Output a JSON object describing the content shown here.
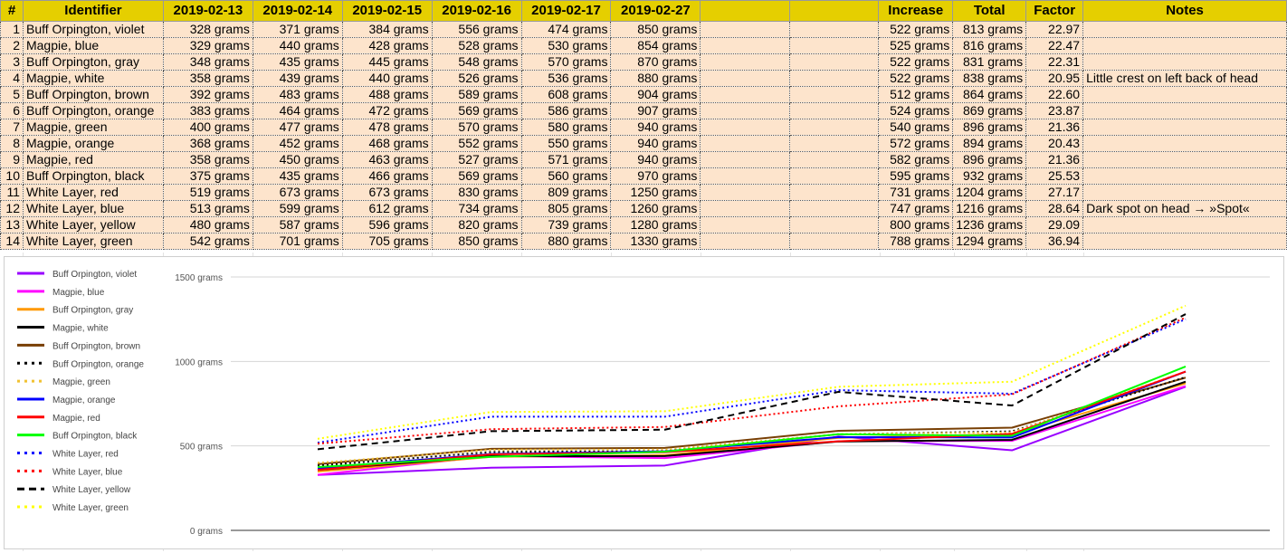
{
  "sheet": {
    "headers": [
      "#",
      "Identifier",
      "2019-02-13",
      "2019-02-14",
      "2019-02-15",
      "2019-02-16",
      "2019-02-17",
      "2019-02-27",
      "",
      "",
      "Increase",
      "Total",
      "Factor",
      "Notes"
    ],
    "rows": [
      [
        "1",
        "Buff Orpington, violet",
        "328 grams",
        "371 grams",
        "384 grams",
        "556 grams",
        "474 grams",
        "850 grams",
        "",
        "",
        "522 grams",
        "813 grams",
        "22.97",
        ""
      ],
      [
        "2",
        "Magpie, blue",
        "329 grams",
        "440 grams",
        "428 grams",
        "528 grams",
        "530 grams",
        "854 grams",
        "",
        "",
        "525 grams",
        "816 grams",
        "22.47",
        ""
      ],
      [
        "3",
        "Buff Orpington, gray",
        "348 grams",
        "435 grams",
        "445 grams",
        "548 grams",
        "570 grams",
        "870 grams",
        "",
        "",
        "522 grams",
        "831 grams",
        "22.31",
        ""
      ],
      [
        "4",
        "Magpie, white",
        "358 grams",
        "439 grams",
        "440 grams",
        "526 grams",
        "536 grams",
        "880 grams",
        "",
        "",
        "522 grams",
        "838 grams",
        "20.95",
        "Little crest on left back of head"
      ],
      [
        "5",
        "Buff Orpington, brown",
        "392 grams",
        "483 grams",
        "488 grams",
        "589 grams",
        "608 grams",
        "904 grams",
        "",
        "",
        "512 grams",
        "864 grams",
        "22.60",
        ""
      ],
      [
        "6",
        "Buff Orpington, orange",
        "383 grams",
        "464 grams",
        "472 grams",
        "569 grams",
        "586 grams",
        "907 grams",
        "",
        "",
        "524 grams",
        "869 grams",
        "23.87",
        ""
      ],
      [
        "7",
        "Magpie, green",
        "400 grams",
        "477 grams",
        "478 grams",
        "570 grams",
        "580 grams",
        "940 grams",
        "",
        "",
        "540 grams",
        "896 grams",
        "21.36",
        ""
      ],
      [
        "8",
        "Magpie, orange",
        "368 grams",
        "452 grams",
        "468 grams",
        "552 grams",
        "550 grams",
        "940 grams",
        "",
        "",
        "572 grams",
        "894 grams",
        "20.43",
        ""
      ],
      [
        "9",
        "Magpie, red",
        "358 grams",
        "450 grams",
        "463 grams",
        "527 grams",
        "571 grams",
        "940 grams",
        "",
        "",
        "582 grams",
        "896 grams",
        "21.36",
        ""
      ],
      [
        "10",
        "Buff Orpington, black",
        "375 grams",
        "435 grams",
        "466 grams",
        "569 grams",
        "560 grams",
        "970 grams",
        "",
        "",
        "595 grams",
        "932 grams",
        "25.53",
        ""
      ],
      [
        "11",
        "White Layer, red",
        "519 grams",
        "673 grams",
        "673 grams",
        "830 grams",
        "809 grams",
        "1250 grams",
        "",
        "",
        "731 grams",
        "1204 grams",
        "27.17",
        ""
      ],
      [
        "12",
        "White Layer, blue",
        "513 grams",
        "599 grams",
        "612 grams",
        "734 grams",
        "805 grams",
        "1260 grams",
        "",
        "",
        "747 grams",
        "1216 grams",
        "28.64",
        "Dark spot on head → »Spot«"
      ],
      [
        "13",
        "White Layer, yellow",
        "480 grams",
        "587 grams",
        "596 grams",
        "820 grams",
        "739 grams",
        "1280 grams",
        "",
        "",
        "800 grams",
        "1236 grams",
        "29.09",
        ""
      ],
      [
        "14",
        "White Layer, green",
        "542 grams",
        "701 grams",
        "705 grams",
        "850 grams",
        "880 grams",
        "1330 grams",
        "",
        "",
        "788 grams",
        "1294 grams",
        "36.94",
        ""
      ]
    ]
  },
  "chart_data": {
    "type": "line",
    "x": [
      "2019-02-13",
      "2019-02-14",
      "2019-02-15",
      "2019-02-16",
      "2019-02-17",
      "2019-02-27"
    ],
    "ylim": [
      0,
      1500
    ],
    "yticks": [
      {
        "value": 0,
        "label": "0 grams"
      },
      {
        "value": 500,
        "label": "500 grams"
      },
      {
        "value": 1000,
        "label": "1000 grams"
      },
      {
        "value": 1500,
        "label": "1500 grams"
      }
    ],
    "grid": true,
    "legend": "left",
    "series": [
      {
        "name": "Buff Orpington, violet",
        "color": "#9900ff",
        "dash": "solid",
        "values": [
          328,
          371,
          384,
          556,
          474,
          850
        ]
      },
      {
        "name": "Magpie, blue",
        "color": "#ff00ff",
        "dash": "solid",
        "values": [
          329,
          440,
          428,
          528,
          530,
          854
        ]
      },
      {
        "name": "Buff Orpington, gray",
        "color": "#ff9900",
        "dash": "solid",
        "values": [
          348,
          435,
          445,
          548,
          570,
          870
        ]
      },
      {
        "name": "Magpie, white",
        "color": "#000000",
        "dash": "solid",
        "values": [
          358,
          439,
          440,
          526,
          536,
          880
        ]
      },
      {
        "name": "Buff Orpington, brown",
        "color": "#783f04",
        "dash": "solid",
        "values": [
          392,
          483,
          488,
          589,
          608,
          904
        ]
      },
      {
        "name": "Buff Orpington, orange",
        "color": "#000000",
        "dash": "dotted",
        "values": [
          383,
          464,
          472,
          569,
          586,
          907
        ]
      },
      {
        "name": "Magpie, green",
        "color": "#f1c232",
        "dash": "dotted",
        "values": [
          400,
          477,
          478,
          570,
          580,
          940
        ]
      },
      {
        "name": "Magpie, orange",
        "color": "#0000ff",
        "dash": "solid",
        "values": [
          368,
          452,
          468,
          552,
          550,
          940
        ]
      },
      {
        "name": "Magpie, red",
        "color": "#ff0000",
        "dash": "solid",
        "values": [
          358,
          450,
          463,
          527,
          571,
          940
        ]
      },
      {
        "name": "Buff Orpington, black",
        "color": "#00ff00",
        "dash": "solid",
        "values": [
          375,
          435,
          466,
          569,
          560,
          970
        ]
      },
      {
        "name": "White Layer, red",
        "color": "#0000ff",
        "dash": "dotted",
        "values": [
          519,
          673,
          673,
          830,
          809,
          1250
        ]
      },
      {
        "name": "White Layer, blue",
        "color": "#ff0000",
        "dash": "dotted",
        "values": [
          513,
          599,
          612,
          734,
          805,
          1260
        ]
      },
      {
        "name": "White Layer, yellow",
        "color": "#000000",
        "dash": "dashed",
        "values": [
          480,
          587,
          596,
          820,
          739,
          1280
        ]
      },
      {
        "name": "White Layer, green",
        "color": "#ffff00",
        "dash": "dotted",
        "values": [
          542,
          701,
          705,
          850,
          880,
          1330
        ]
      }
    ]
  }
}
